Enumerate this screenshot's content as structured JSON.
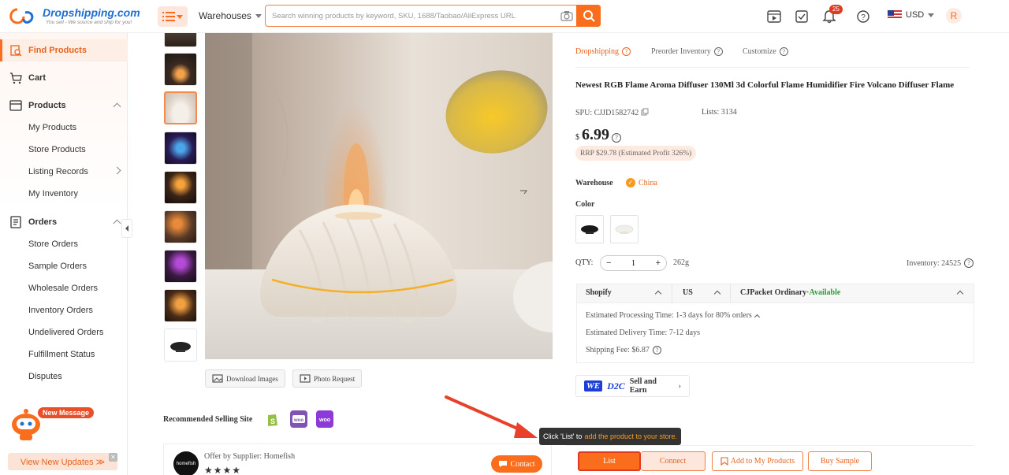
{
  "header": {
    "brand": "Dropshipping.com",
    "slogan": "You sell - We source and ship for you!",
    "warehouses_label": "Warehouses",
    "search_placeholder": "Search winning products by keyword, SKU, 1688/Taobao/AliExpress URL",
    "notification_count": "25",
    "currency": "USD",
    "avatar_initial": "R"
  },
  "sidebar": {
    "find_products": "Find Products",
    "cart": "Cart",
    "products": "Products",
    "my_products": "My Products",
    "store_products": "Store Products",
    "listing_records": "Listing Records",
    "my_inventory": "My Inventory",
    "orders": "Orders",
    "store_orders": "Store Orders",
    "sample_orders": "Sample Orders",
    "wholesale_orders": "Wholesale Orders",
    "inventory_orders": "Inventory Orders",
    "undelivered_orders": "Undelivered Orders",
    "fulfillment_status": "Fulfillment Status",
    "disputes": "Disputes",
    "new_message": "New Message",
    "view_updates": "View New Updates ≫"
  },
  "gallery": {
    "download_images": "Download Images",
    "photo_request": "Photo Request",
    "recommended_label": "Recommended Selling Site"
  },
  "supplier": {
    "offer_text": "Offer by Supplier: Homefish",
    "logo_text": "homefish",
    "stars": "★★★★",
    "contact": "Contact"
  },
  "product": {
    "tabs": [
      "Dropshipping",
      "Preorder Inventory",
      "Customize"
    ],
    "title": "Newest RGB Flame Aroma Diffuser 130Ml 3d Colorful Flame Humidifier Fire Volcano Diffuser Flame",
    "spu": "SPU: CJJD1582742",
    "lists": "Lists: 3134",
    "currency_symbol": "$",
    "price": "6.99",
    "rrp": "RRP $29.78 (Estimated Profit 326%)",
    "warehouse_label": "Warehouse",
    "warehouse_value": "China",
    "color_label": "Color",
    "qty_label": "QTY:",
    "qty_value": "1",
    "weight": "262g",
    "inventory": "Inventory: 24525"
  },
  "shipping": {
    "platform": "Shopify",
    "country": "US",
    "method": "CJPacket Ordinary",
    "availability": "·Available",
    "processing": "Estimated Processing Time:  1-3 days for 80% orders",
    "delivery": "Estimated Delivery Time:  7-12 days",
    "fee": "Shipping Fee:  $6.87"
  },
  "d2c": {
    "we": "WE",
    "d2c": "D2C",
    "label": "Sell and Earn"
  },
  "tooltip": {
    "text": "Click 'List' to",
    "highlight": "add the product to your store."
  },
  "actions": {
    "list": "List",
    "connect": "Connect",
    "add_to_my_products": "Add to My Products",
    "buy_sample": "Buy Sample"
  },
  "colors": {
    "accent": "#f96d1c",
    "brand_blue": "#1f6fd1"
  }
}
